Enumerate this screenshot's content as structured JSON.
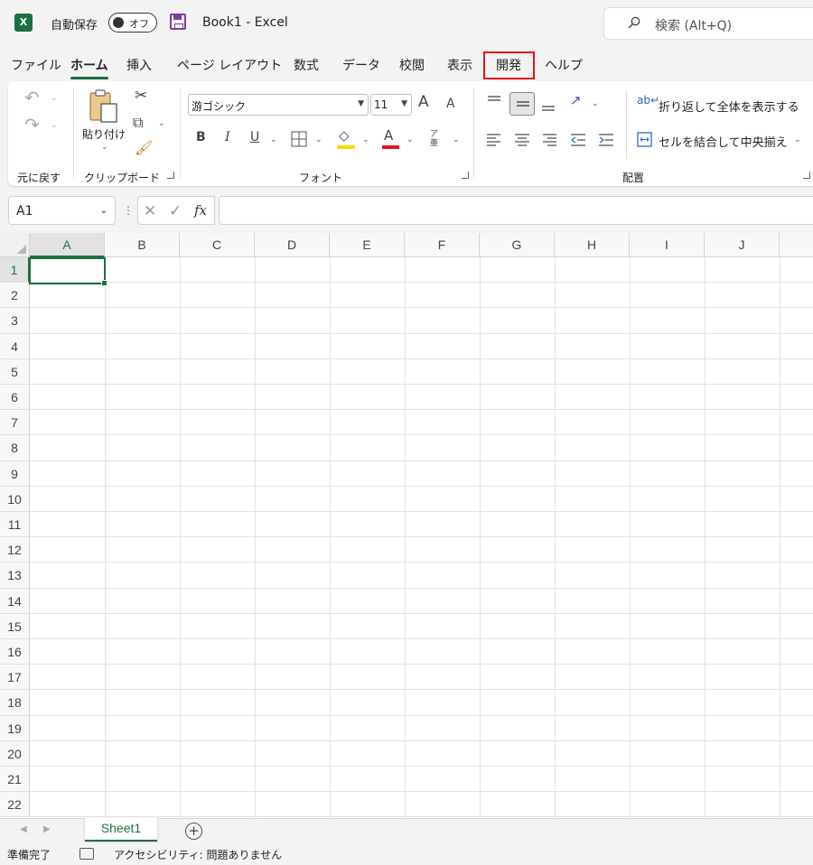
{
  "titlebar": {
    "app_icon": "excel-logo-icon",
    "app_icon_letter": "X",
    "autosave_label": "自動保存",
    "autosave_state": "オフ",
    "save_icon": "save-icon",
    "doc_title": "Book1  -  Excel",
    "search_placeholder": "検索 (Alt+Q)"
  },
  "ribbon_tabs": [
    {
      "label": "ファイル",
      "active": false
    },
    {
      "label": "ホーム",
      "active": true
    },
    {
      "label": "挿入",
      "active": false
    },
    {
      "label": "ページ レイアウト",
      "active": false
    },
    {
      "label": "数式",
      "active": false
    },
    {
      "label": "データ",
      "active": false
    },
    {
      "label": "校閲",
      "active": false
    },
    {
      "label": "表示",
      "active": false
    },
    {
      "label": "開発",
      "active": false,
      "highlighted": true
    },
    {
      "label": "ヘルプ",
      "active": false
    }
  ],
  "ribbon": {
    "undo_group_label": "元に戻す",
    "clipboard": {
      "paste_label": "貼り付け",
      "group_label": "クリップボード"
    },
    "font": {
      "font_name": "游ゴシック",
      "font_size": "11",
      "bold": "B",
      "italic": "I",
      "underline": "U",
      "font_color_glyph": "A",
      "grow_font": "A",
      "shrink_font": "A",
      "phonetic": "ア亜",
      "group_label": "フォント",
      "highlight_color": "#ffd700",
      "font_color": "#e8121a"
    },
    "alignment": {
      "wrap_text": "折り返して全体を表示する",
      "merge_center": "セルを結合して中央揃え",
      "group_label": "配置"
    }
  },
  "formula_bar": {
    "name_box": "A1",
    "fx": "fx",
    "cancel": "✕",
    "enter": "✓",
    "value": ""
  },
  "grid": {
    "columns": [
      "A",
      "B",
      "C",
      "D",
      "E",
      "F",
      "G",
      "H",
      "I",
      "J"
    ],
    "rows": [
      "1",
      "2",
      "3",
      "4",
      "5",
      "6",
      "7",
      "8",
      "9",
      "10",
      "11",
      "12",
      "13",
      "14",
      "15",
      "16",
      "17",
      "18",
      "19",
      "20",
      "21",
      "22"
    ],
    "selected_cell": "A1"
  },
  "sheets": {
    "tabs": [
      "Sheet1"
    ],
    "add_label": "+"
  },
  "status": {
    "ready": "準備完了",
    "accessibility": "アクセシビリティ: 問題ありません"
  },
  "colors": {
    "accent": "#1d6f42",
    "highlight_box": "#e8121a"
  }
}
